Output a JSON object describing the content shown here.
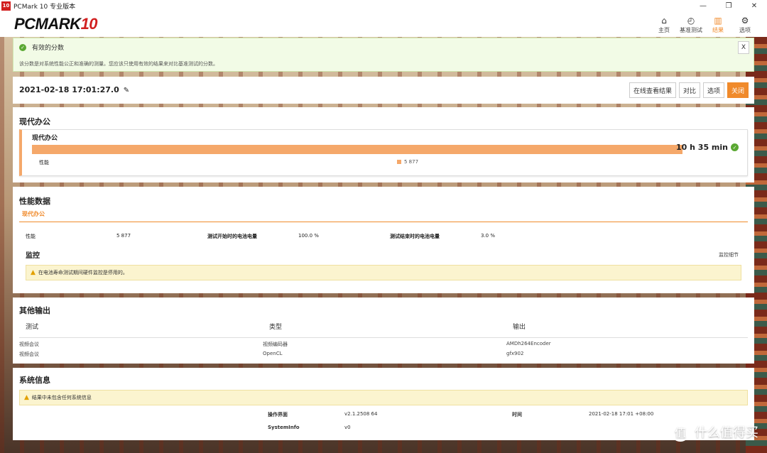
{
  "window": {
    "title": "PCMark 10 专业版本",
    "logo": "10"
  },
  "brand": {
    "main": "PCMARK",
    "num": "10"
  },
  "nav": [
    {
      "label": "主页",
      "icon": "⌂"
    },
    {
      "label": "基准测试",
      "icon": "◴"
    },
    {
      "label": "结果",
      "icon": "▥"
    },
    {
      "label": "选项",
      "icon": "⚙"
    }
  ],
  "notice": {
    "title": "有效的分数",
    "text": "该分数是对系统性能公正和准确的测量。您应该只使用有效的结果来对比基准测试的分数。",
    "close": "X"
  },
  "result": {
    "datetime": "2021-02-18 17:01:27.0",
    "buttons": {
      "online": "在线查看结果",
      "compare": "对比",
      "options": "选项",
      "close": "关闭"
    }
  },
  "office": {
    "title": "现代办公",
    "subtitle": "现代办公",
    "duration": "10 h 35 min",
    "perf_label": "性能",
    "legend_value": "5 877"
  },
  "perfdata": {
    "title": "性能数据",
    "tab": "现代办公",
    "perf_label": "性能",
    "perf_value": "5 877",
    "start_label": "测试开始时的电池电量",
    "start_value": "100.0 %",
    "end_label": "测试结束时的电池电量",
    "end_value": "3.0 %",
    "monitor_title": "监控",
    "monitor_link": "监控细节",
    "warning": "在电池寿命测试期间硬件监控是停用的。"
  },
  "other": {
    "title": "其他输出",
    "headers": [
      "测试",
      "类型",
      "输出"
    ],
    "rows": [
      [
        "视频会议",
        "视频编码器",
        "AMDh264Encoder"
      ],
      [
        "视频会议",
        "OpenCL",
        "gfx902"
      ]
    ]
  },
  "sysinfo": {
    "title": "系统信息",
    "warning": "结果中未包含任何系统信息",
    "os_label": "操作界面",
    "os_value": "v2.1.2508 64",
    "time_label": "时间",
    "time_value": "2021-02-18 17:01 +08:00",
    "si_label": "SystemInfo",
    "si_value": "v0"
  },
  "watermark": {
    "icon": "值",
    "text": "什么值得买"
  },
  "colors": {
    "accent": "#f08a2b",
    "bar": "#f5a86a",
    "ok": "#5aa832",
    "warn_bg": "#fbf4cf"
  }
}
